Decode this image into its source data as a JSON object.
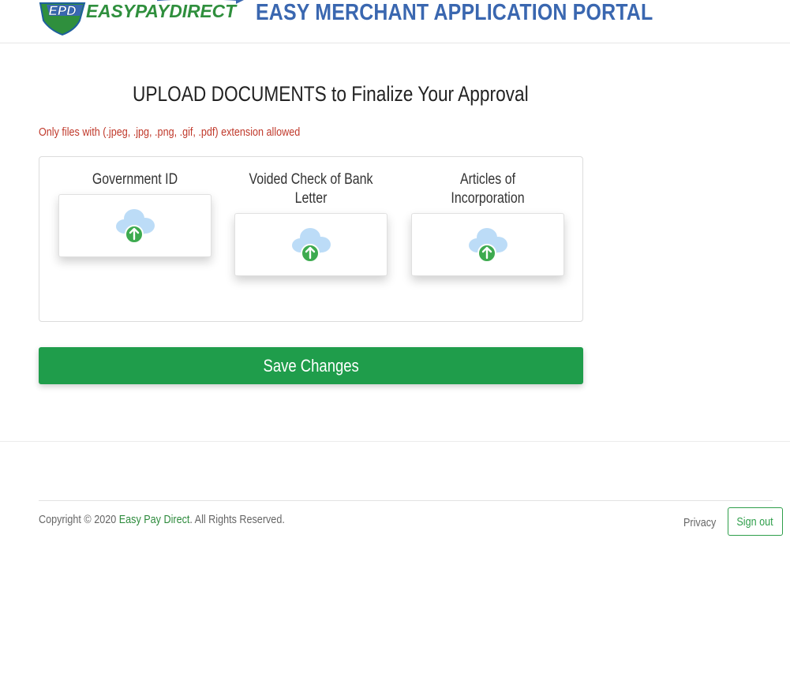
{
  "header": {
    "logo_mark": "EPD",
    "logo_text": "EASYPAYDIRECT",
    "portal_title": "EASY MERCHANT APPLICATION PORTAL"
  },
  "main": {
    "heading": "UPLOAD DOCUMENTS to Finalize Your Approval",
    "notice": "Only files with (.jpeg, .jpg, .png, .gif, .pdf) extension allowed",
    "upload_slots": [
      {
        "label": "Government ID",
        "icon": "cloud-upload-icon"
      },
      {
        "label": "Voided Check of Bank Letter",
        "icon": "cloud-upload-icon"
      },
      {
        "label": "Articles of Incorporation",
        "icon": "cloud-upload-icon"
      }
    ],
    "save_label": "Save Changes"
  },
  "footer": {
    "copyright_prefix": "Copyright © 2020 ",
    "company_link": "Easy Pay Direct",
    "copyright_suffix": ". All Rights Reserved.",
    "privacy_label": "Privacy",
    "signout_label": "Sign out"
  },
  "colors": {
    "brand_blue": "#3a67b0",
    "primary_green": "#1f9d4b",
    "notice_red": "#c0392b",
    "cloud_blue": "#bcdcf7",
    "arrow_green": "#3daa4f"
  }
}
